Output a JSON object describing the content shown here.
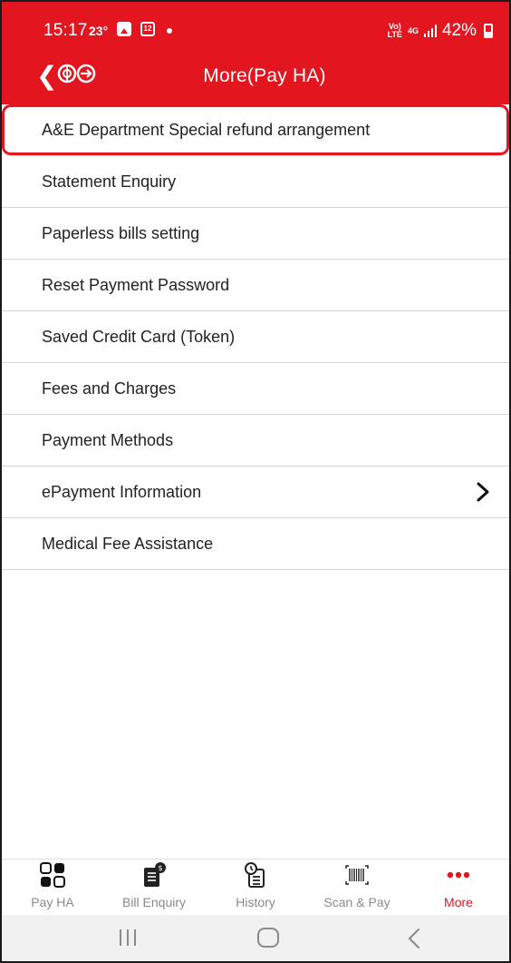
{
  "status_bar": {
    "time": "15:17",
    "temperature": "23°",
    "calendar_day": "12",
    "network_top": "Vo)",
    "network_bottom": "LTE",
    "network_type": "4G",
    "battery": "42%"
  },
  "nav": {
    "title": "More(Pay HA)",
    "back_icon": "chevron-left-icon",
    "logo_icon": "ha-go-logo"
  },
  "menu": {
    "items": [
      {
        "label": "A&E Department Special refund arrangement",
        "highlighted": true
      },
      {
        "label": "Statement Enquiry"
      },
      {
        "label": "Paperless bills setting"
      },
      {
        "label": "Reset Payment Password"
      },
      {
        "label": "Saved Credit Card (Token)"
      },
      {
        "label": "Fees and Charges"
      },
      {
        "label": "Payment Methods"
      },
      {
        "label": "ePayment Information",
        "icon": "chevron-right-icon"
      },
      {
        "label": "Medical Fee Assistance"
      }
    ]
  },
  "tabs": [
    {
      "label": "Pay HA",
      "icon": "grid-icon"
    },
    {
      "label": "Bill Enquiry",
      "icon": "bill-enquiry-icon"
    },
    {
      "label": "History",
      "icon": "history-icon"
    },
    {
      "label": "Scan & Pay",
      "icon": "barcode-scan-icon"
    },
    {
      "label": "More",
      "icon": "more-dots-icon",
      "active": true
    }
  ],
  "colors": {
    "brand_red": "#e3161f",
    "tab_inactive": "#8a8a8a",
    "divider": "#d5d5d5"
  }
}
